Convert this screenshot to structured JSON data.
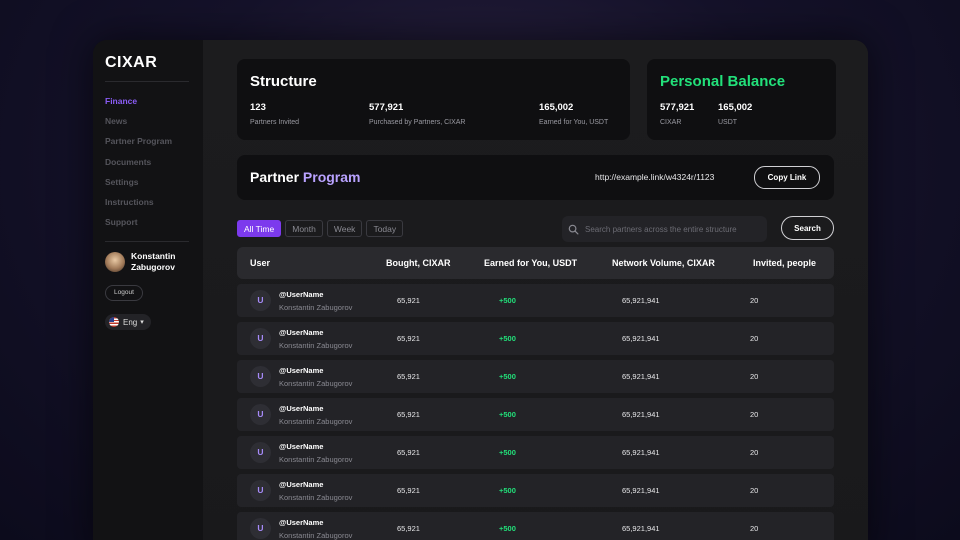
{
  "app": {
    "logo_text": "CIXAR",
    "colors": {
      "accent": "#7c3aed",
      "positive": "#22e07a",
      "link": "#b9a2ff"
    }
  },
  "sidebar": {
    "items": [
      {
        "label": "Finance",
        "active": true
      },
      {
        "label": "News"
      },
      {
        "label": "Partner Program"
      },
      {
        "label": "Documents"
      },
      {
        "label": "Settings"
      },
      {
        "label": "Instructions"
      },
      {
        "label": "Support"
      }
    ],
    "user": {
      "name": "Konstantin Zabugorov"
    },
    "logout_label": "Logout",
    "language": "Eng"
  },
  "structure": {
    "title": "Structure",
    "stats": [
      {
        "value": "123",
        "label": "Partners Invited"
      },
      {
        "value": "577,921",
        "label": "Purchased by Partners, CIXAR"
      },
      {
        "value": "165,002",
        "label": "Earned for You, USDT"
      }
    ]
  },
  "balance": {
    "title": "Personal Balance",
    "stats": [
      {
        "value": "577,921",
        "label": "CIXAR"
      },
      {
        "value": "165,002",
        "label": "USDT"
      }
    ]
  },
  "partner": {
    "title_part1": "Partner",
    "title_part2": "Program",
    "link": "http://example.link/w4324r/1123",
    "copy_label": "Copy Link"
  },
  "filters": [
    {
      "label": "All Time",
      "active": true
    },
    {
      "label": "Month"
    },
    {
      "label": "Week"
    },
    {
      "label": "Today"
    }
  ],
  "search": {
    "placeholder": "Search partners across the entire structure",
    "button_label": "Search"
  },
  "table": {
    "headers": [
      "User",
      "Bought, CIXAR",
      "Earned for You, USDT",
      "Network Volume, CIXAR",
      "Invited, people"
    ],
    "rows": [
      {
        "initial": "U",
        "username": "@UserName",
        "fullname": "Konstantin Zabugorov",
        "bought": "65,921",
        "earned": "+500",
        "volume": "65,921,941",
        "invited": "20"
      },
      {
        "initial": "U",
        "username": "@UserName",
        "fullname": "Konstantin Zabugorov",
        "bought": "65,921",
        "earned": "+500",
        "volume": "65,921,941",
        "invited": "20"
      },
      {
        "initial": "U",
        "username": "@UserName",
        "fullname": "Konstantin Zabugorov",
        "bought": "65,921",
        "earned": "+500",
        "volume": "65,921,941",
        "invited": "20"
      },
      {
        "initial": "U",
        "username": "@UserName",
        "fullname": "Konstantin Zabugorov",
        "bought": "65,921",
        "earned": "+500",
        "volume": "65,921,941",
        "invited": "20"
      },
      {
        "initial": "U",
        "username": "@UserName",
        "fullname": "Konstantin Zabugorov",
        "bought": "65,921",
        "earned": "+500",
        "volume": "65,921,941",
        "invited": "20"
      },
      {
        "initial": "U",
        "username": "@UserName",
        "fullname": "Konstantin Zabugorov",
        "bought": "65,921",
        "earned": "+500",
        "volume": "65,921,941",
        "invited": "20"
      },
      {
        "initial": "U",
        "username": "@UserName",
        "fullname": "Konstantin Zabugorov",
        "bought": "65,921",
        "earned": "+500",
        "volume": "65,921,941",
        "invited": "20"
      }
    ]
  }
}
